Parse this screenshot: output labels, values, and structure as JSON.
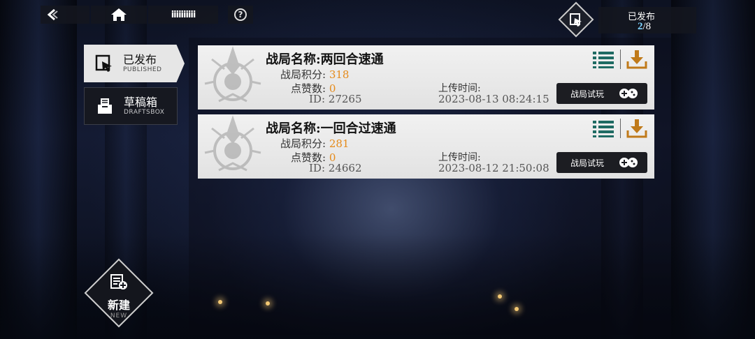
{
  "topbar": {
    "player_name": "iiiiiiiiii",
    "help_label": "?"
  },
  "publish_status": {
    "label": "已发布",
    "current": "2",
    "total": "/8"
  },
  "tabs": [
    {
      "label_cn": "已发布",
      "label_en": "PUBLISHED",
      "active": true
    },
    {
      "label_cn": "草稿箱",
      "label_en": "DRAFTSBOX",
      "active": false
    }
  ],
  "cards": [
    {
      "title_prefix": "战局名称:",
      "title": "两回合速通",
      "score_label": "战局积分:",
      "score": "318",
      "likes_label": "点赞数:",
      "likes": "0",
      "id_label": "ID:",
      "id": "27265",
      "upload_label": "上传时间:",
      "upload_time": "2023-08-13 08:24:15",
      "try_label": "战局试玩"
    },
    {
      "title_prefix": "战局名称:",
      "title": "一回合过速通",
      "score_label": "战局积分:",
      "score": "281",
      "likes_label": "点赞数:",
      "likes": "0",
      "id_label": "ID:",
      "id": "24662",
      "upload_label": "上传时间:",
      "upload_time": "2023-08-12 21:50:08",
      "try_label": "战局试玩"
    }
  ],
  "new_button": {
    "label_cn": "新建",
    "label_en": "NEW"
  },
  "colors": {
    "accent_orange": "#e58a19",
    "list_teal": "#1f6b63",
    "download_orange": "#c07a1a",
    "count_blue": "#7fd3ff"
  },
  "icons": [
    "back-arrow-icon",
    "home-icon",
    "help-icon",
    "published-icon",
    "drafts-icon",
    "list-icon",
    "download-icon",
    "gamepad-icon",
    "new-doc-icon"
  ]
}
